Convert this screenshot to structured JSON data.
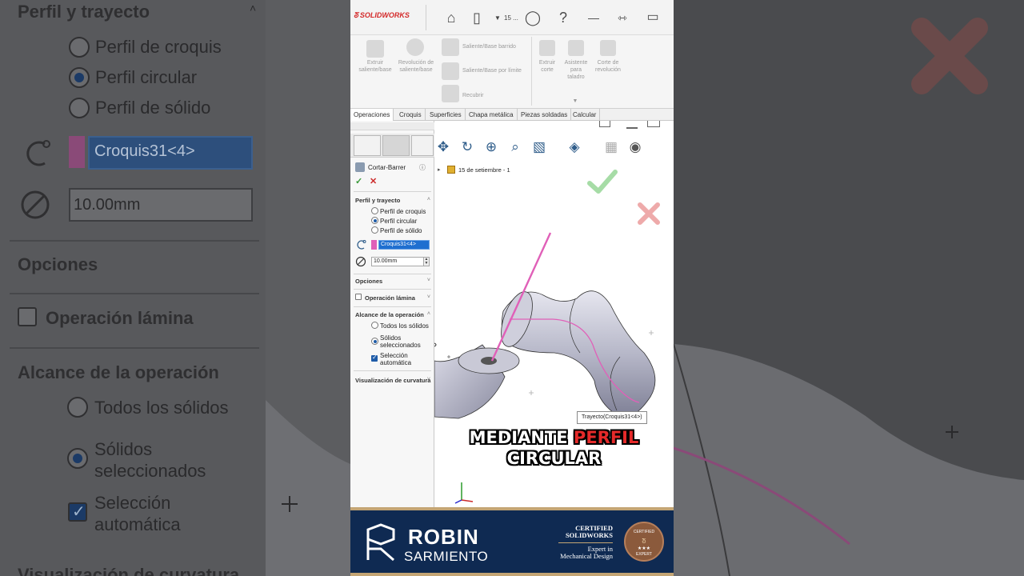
{
  "app": {
    "brand_name": "SOLIDWORKS",
    "file_short": "15 ..."
  },
  "ribbon": {
    "extrude_boss": "Extruir saliente/base",
    "revolve_boss": "Revolución de saliente/base",
    "sweep_boss": "Saliente/Base barrido",
    "loft_boss": "Saliente/Base por límite",
    "wrap": "Recubrir",
    "extrude_cut": "Extruir corte",
    "hole_wizard": "Asistente para taladro",
    "revolve_cut": "Corte de revolución"
  },
  "tabs": [
    "Operaciones",
    "Croquis",
    "Superficies",
    "Chapa metálica",
    "Piezas soldadas",
    "Calcular"
  ],
  "property_manager": {
    "title": "Cortar-Barrer",
    "profile_section": {
      "title": "Perfil y trayecto",
      "options": [
        "Perfil de croquis",
        "Perfil circular",
        "Perfil de sólido"
      ],
      "selected_index": 1,
      "path_selection": "Croquis31<4>",
      "diameter": "10.00mm"
    },
    "options_section": "Opciones",
    "thin_feature": {
      "label": "Operación lámina",
      "checked": false
    },
    "feature_scope": {
      "title": "Alcance de la operación",
      "all_bodies": "Todos los sólidos",
      "selected_bodies": "Sólidos seleccionados",
      "auto_select": "Selección automática",
      "selected_bodies_on": true,
      "auto_select_checked": true
    },
    "curvature_display": "Visualización de curvatura"
  },
  "viewport": {
    "tree_root": "15 de setiembre  - 1",
    "tooltip": "Trayecto(Croquis31<4>)",
    "caption_line1_a": "MEDIANTE",
    "caption_line1_b": "PERFIL",
    "caption_line2": "CIRCULAR"
  },
  "banner": {
    "name_first": "ROBIN",
    "name_last": "SARMIENTO",
    "cert_line1": "CERTIFIED",
    "cert_line2": "SOLIDWORKS",
    "cert_line3": "Expert in",
    "cert_line4": "Mechanical Design",
    "badge_top": "CERTIFIED",
    "badge_bottom": "EXPERT",
    "badge_stars": "★★★"
  },
  "colors": {
    "accent_blue": "#1f6fd0",
    "path_pink": "#e060b8",
    "brand_navy": "#0f2a52",
    "brand_gold": "#c4a574",
    "caption_red": "#e62a2a",
    "confirm_green": "#7fc77f",
    "cancel_red": "#e27a7a"
  }
}
